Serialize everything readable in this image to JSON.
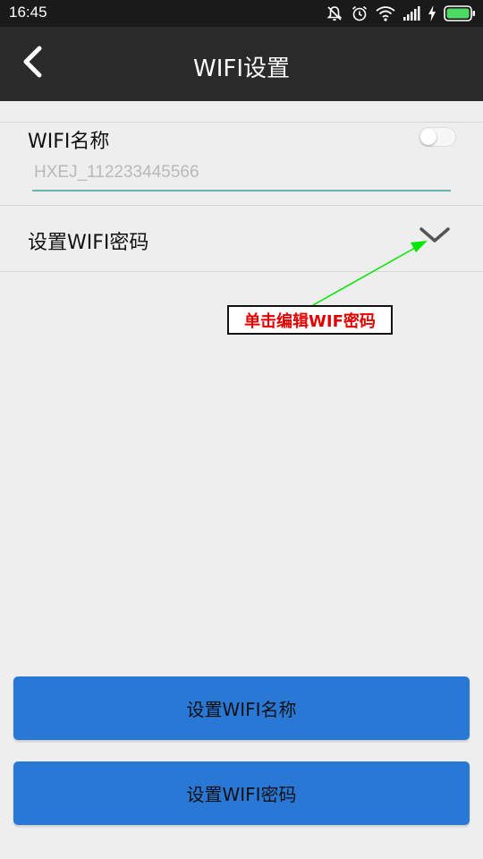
{
  "status_bar": {
    "time": "16:45",
    "icons": [
      "mute-icon",
      "alarm-icon",
      "wifi-icon",
      "signal-icon",
      "charging-icon",
      "battery-icon"
    ],
    "battery_color": "#4cd964"
  },
  "app_bar": {
    "title": "WIFI设置",
    "back_icon": "chevron-left-icon"
  },
  "wifi_name": {
    "label": "WIFI名称",
    "placeholder": "HXEJ_112233445566",
    "value": "",
    "toggle_on": false,
    "underline_color": "#69b5ad"
  },
  "wifi_password": {
    "label": "设置WIFI密码",
    "expand_icon": "chevron-down-icon"
  },
  "annotation": {
    "text": "单击编辑WIF密码",
    "text_color": "#e60000",
    "arrow_color": "#00e600"
  },
  "buttons": {
    "set_name": "设置WIFI名称",
    "set_password": "设置WIFI密码",
    "color": "#2a78d6"
  }
}
